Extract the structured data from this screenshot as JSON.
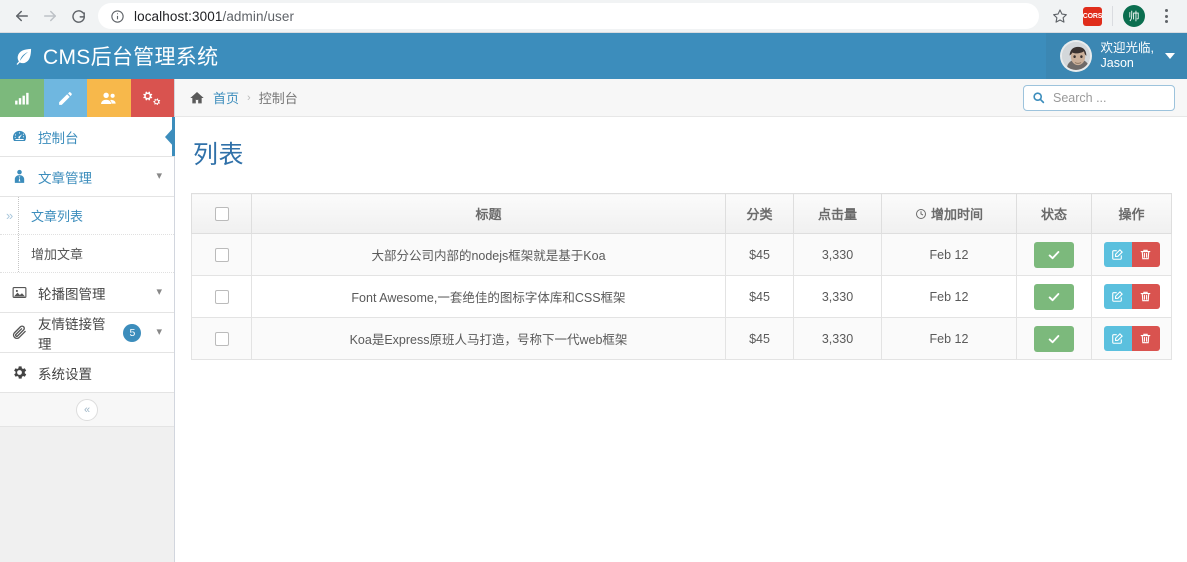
{
  "browser": {
    "back_icon": "back-arrow-icon",
    "forward_icon": "forward-arrow-icon",
    "reload_icon": "reload-icon",
    "info_icon": "info-circle-icon",
    "url_host": "localhost:3001",
    "url_path": "/admin/user",
    "star_icon": "bookmark-star-icon",
    "extension_label": "CORS",
    "profile_initial": "帅",
    "menu_icon": "three-dots-menu-icon"
  },
  "app_header": {
    "brand_icon": "leaf-icon",
    "brand_title": "CMS后台管理系统",
    "user_greeting": "欢迎光临,",
    "user_name": "Jason",
    "avatar_icon": "user-avatar",
    "caret_icon": "caret-down-icon"
  },
  "sidebar": {
    "quick_icons": [
      {
        "name": "bar-chart-icon",
        "color": "#7cb97c"
      },
      {
        "name": "pencil-icon",
        "color": "#6fb7e0"
      },
      {
        "name": "users-icon",
        "color": "#f7b84b"
      },
      {
        "name": "cogs-icon",
        "color": "#d9534f"
      }
    ],
    "items": [
      {
        "label": "控制台",
        "icon": "dashboard-icon",
        "active": true,
        "chevron": "",
        "badge": ""
      },
      {
        "label": "文章管理",
        "icon": "user-tie-icon",
        "active": false,
        "chevron": "chevron-down-icon",
        "badge": ""
      },
      {
        "label": "轮播图管理",
        "icon": "image-icon",
        "active": false,
        "chevron": "chevron-down-icon",
        "badge": ""
      },
      {
        "label": "友情链接管理",
        "icon": "link-paperclip-icon",
        "active": false,
        "chevron": "chevron-down-icon",
        "badge": "5"
      },
      {
        "label": "系统设置",
        "icon": "gear-icon",
        "active": false,
        "chevron": "",
        "badge": ""
      }
    ],
    "submenu": [
      {
        "label": "文章列表",
        "active": true
      },
      {
        "label": "增加文章",
        "active": false
      }
    ],
    "collapse_icon": "double-chevron-left-icon"
  },
  "content": {
    "breadcrumb": {
      "home_icon": "home-icon",
      "home_label": "首页",
      "separator": "›",
      "current": "控制台"
    },
    "search": {
      "icon": "search-icon",
      "placeholder": "Search ...",
      "value": ""
    },
    "page_title": "列表",
    "table": {
      "columns": [
        {
          "key": "checkbox",
          "label": ""
        },
        {
          "key": "title",
          "label": "标题"
        },
        {
          "key": "category",
          "label": "分类"
        },
        {
          "key": "hits",
          "label": "点击量"
        },
        {
          "key": "time",
          "label": "增加时间",
          "icon": "clock-icon"
        },
        {
          "key": "status",
          "label": "状态"
        },
        {
          "key": "actions",
          "label": "操作"
        }
      ],
      "rows": [
        {
          "title": "大部分公司内部的nodejs框架就是基于Koa",
          "category": "$45",
          "hits": "3,330",
          "time": "Feb 12",
          "status_icon": "check-icon",
          "edit_icon": "edit-square-icon",
          "delete_icon": "trash-icon"
        },
        {
          "title": "Font Awesome,一套绝佳的图标字体库和CSS框架",
          "category": "$45",
          "hits": "3,330",
          "time": "Feb 12",
          "status_icon": "check-icon",
          "edit_icon": "edit-square-icon",
          "delete_icon": "trash-icon"
        },
        {
          "title": "Koa是Express原班人马打造，号称下一代web框架",
          "category": "$45",
          "hits": "3,330",
          "time": "Feb 12",
          "status_icon": "check-icon",
          "edit_icon": "edit-square-icon",
          "delete_icon": "trash-icon"
        }
      ]
    }
  },
  "colors": {
    "brand_blue": "#3c8dbc",
    "title_blue": "#3071a9",
    "status_green": "#7cb97c",
    "edit_blue": "#5bc0de",
    "delete_red": "#d9534f"
  }
}
